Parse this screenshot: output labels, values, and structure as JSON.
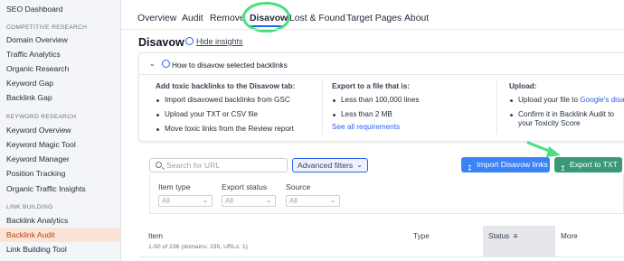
{
  "sidebar": {
    "top_item": "SEO Dashboard",
    "sections": [
      {
        "title": "COMPETITIVE RESEARCH",
        "items": [
          "Domain Overview",
          "Traffic Analytics",
          "Organic Research",
          "Keyword Gap",
          "Backlink Gap"
        ]
      },
      {
        "title": "KEYWORD RESEARCH",
        "items": [
          "Keyword Overview",
          "Keyword Magic Tool",
          "Keyword Manager",
          "Position Tracking",
          "Organic Traffic Insights"
        ]
      },
      {
        "title": "LINK BUILDING",
        "items": [
          "Backlink Analytics",
          "Backlink Audit",
          "Link Building Tool"
        ]
      }
    ],
    "active_item": "Backlink Audit"
  },
  "tabs": [
    "Overview",
    "Audit",
    "Remove",
    "Disavow",
    "Lost & Found",
    "Target Pages",
    "About"
  ],
  "active_tab": "Disavow",
  "page": {
    "title": "Disavow",
    "hide_insights": "Hide insights"
  },
  "insights": {
    "title": "How to disavow selected backlinks",
    "col1": {
      "heading": "Add toxic backlinks to the Disavow tab:",
      "items": [
        "Import disavowed backlinks from GSC",
        "Upload your TXT or CSV file",
        "Move toxic links from the Review report"
      ]
    },
    "col2": {
      "heading": "Export to a file that is:",
      "items": [
        "Less than 100,000 lines",
        "Less than 2 MB"
      ],
      "link": "See all requirements"
    },
    "col3": {
      "heading": "Upload:",
      "item1_prefix": "Upload your file to ",
      "item1_link": "Google's disa",
      "item2_line1": "Confirm it in Backlink Audit to",
      "item2_line2": "your Toxicity Score"
    }
  },
  "toolbar": {
    "search_placeholder": "Search for URL",
    "advanced_filters": "Advanced filters",
    "import_button": "Import Disavow links",
    "export_button": "Export to TXT"
  },
  "filters": [
    {
      "label": "Item type",
      "value": "All"
    },
    {
      "label": "Export status",
      "value": "All"
    },
    {
      "label": "Source",
      "value": "All"
    }
  ],
  "table": {
    "col_item": "Item",
    "summary": "1-50 of 236 (domains: 235, URLs: 1)",
    "col_type": "Type",
    "col_status": "Status",
    "col_more": "More"
  },
  "colors": {
    "accent_blue": "#2563eb",
    "export_green": "#3a9a77",
    "active_sidebar_bg": "#fbe3d7",
    "highlight_green": "#4ade80"
  }
}
